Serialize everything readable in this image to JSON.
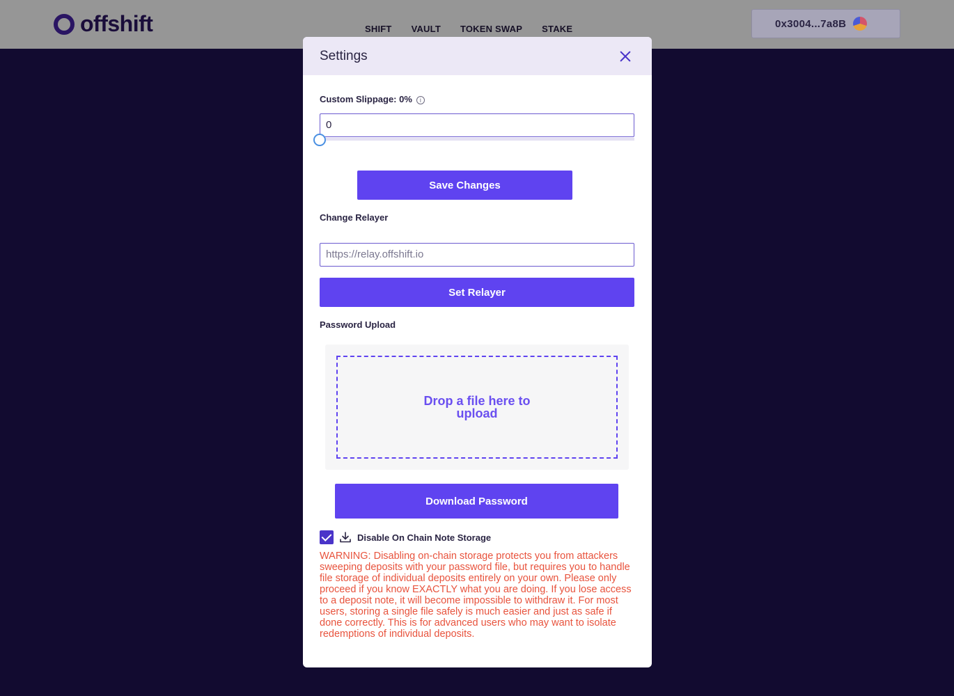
{
  "brand": {
    "name": "offshift"
  },
  "nav": {
    "items": [
      "SHIFT",
      "VAULT",
      "TOKEN SWAP",
      "STAKE"
    ]
  },
  "wallet": {
    "address": "0x3004...7a8B"
  },
  "settings": {
    "title": "Settings",
    "slippage": {
      "label": "Custom Slippage: 0%",
      "value": "0",
      "slider_value": 0
    },
    "save_label": "Save Changes",
    "relayer": {
      "label": "Change Relayer",
      "placeholder": "https://relay.offshift.io",
      "button_label": "Set Relayer"
    },
    "password_upload": {
      "label": "Password Upload",
      "drop_text": "Drop a file here to upload"
    },
    "download_label": "Download Password",
    "disable_storage": {
      "label": "Disable On Chain Note Storage",
      "checked": true
    },
    "warning": "WARNING: Disabling on-chain storage protects you from attackers sweeping deposits with your password file, but requires you to handle file storage of individual deposits entirely on your own. Please only proceed if you know EXACTLY what you are doing. If you lose access to a deposit note, it will become impossible to withdraw it. For most users, storing a single file safely is much easier and just as safe if done correctly. This is for advanced users who may want to isolate redemptions of individual deposits."
  },
  "colors": {
    "accent": "#5f43f0",
    "warning": "#e8533d",
    "background": "#120b30"
  }
}
